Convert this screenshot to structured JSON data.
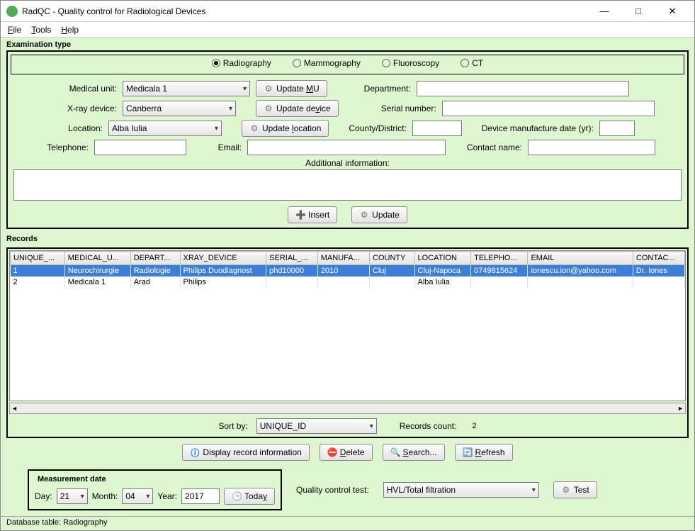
{
  "window": {
    "title": "RadQC - Quality control for Radiological Devices"
  },
  "menu": {
    "file": "File",
    "tools": "Tools",
    "help": "Help"
  },
  "exam": {
    "title": "Examination type",
    "options": {
      "radiography": "Radiography",
      "mammography": "Mammography",
      "fluoroscopy": "Fluoroscopy",
      "ct": "CT"
    },
    "selected": "radiography"
  },
  "form": {
    "medicalUnit_label": "Medical unit:",
    "medicalUnit_value": "Medicala 1",
    "updateMU": "Update MU",
    "department_label": "Department:",
    "department_value": "",
    "xray_label": "X-ray device:",
    "xray_value": "Canberra",
    "updateDevice": "Update device",
    "serial_label": "Serial number:",
    "serial_value": "",
    "location_label": "Location:",
    "location_value": "Alba Iulia",
    "updateLocation": "Update location",
    "county_label": "County/District:",
    "county_value": "",
    "mfgdate_label": "Device manufacture date (yr):",
    "mfgdate_value": "",
    "telephone_label": "Telephone:",
    "telephone_value": "",
    "email_label": "Email:",
    "email_value": "",
    "contact_label": "Contact name:",
    "contact_value": "",
    "additional_label": "Additional information:",
    "additional_value": "",
    "insert": "Insert",
    "update": "Update"
  },
  "records": {
    "title": "Records",
    "headers": [
      "UNIQUE_...",
      "MEDICAL_U...",
      "DEPART...",
      "XRAY_DEVICE",
      "SERIAL_...",
      "MANUFA...",
      "COUNTY",
      "LOCATION",
      "TELEPHO...",
      "EMAIL",
      "CONTAC..."
    ],
    "rows": [
      {
        "sel": true,
        "cells": [
          "1",
          "Neurochirurgie",
          "Radiologie",
          "Philips Duodiagnost",
          "phd10000",
          "2010",
          "Cluj",
          "Cluj-Napoca",
          "0749815624",
          "ionescu.ion@yahoo.com",
          "Dr. Iones"
        ]
      },
      {
        "sel": false,
        "cells": [
          "2",
          "Medicala 1",
          "Arad",
          "Philips",
          "",
          "",
          "",
          "Alba Iulia",
          "",
          "",
          ""
        ]
      }
    ],
    "sortby_label": "Sort by:",
    "sortby_value": "UNIQUE_ID",
    "count_label": "Records count:",
    "count_value": "2"
  },
  "actions": {
    "display": "Display record information",
    "delete": "Delete",
    "search": "Search...",
    "refresh": "Refresh"
  },
  "measurement": {
    "title": "Measurement date",
    "day_label": "Day:",
    "day": "21",
    "month_label": "Month:",
    "month": "04",
    "year_label": "Year:",
    "year": "2017",
    "today": "Today"
  },
  "qc": {
    "label": "Quality control test:",
    "value": "HVL/Total filtration",
    "test": "Test"
  },
  "status": "Database table: Radiography"
}
